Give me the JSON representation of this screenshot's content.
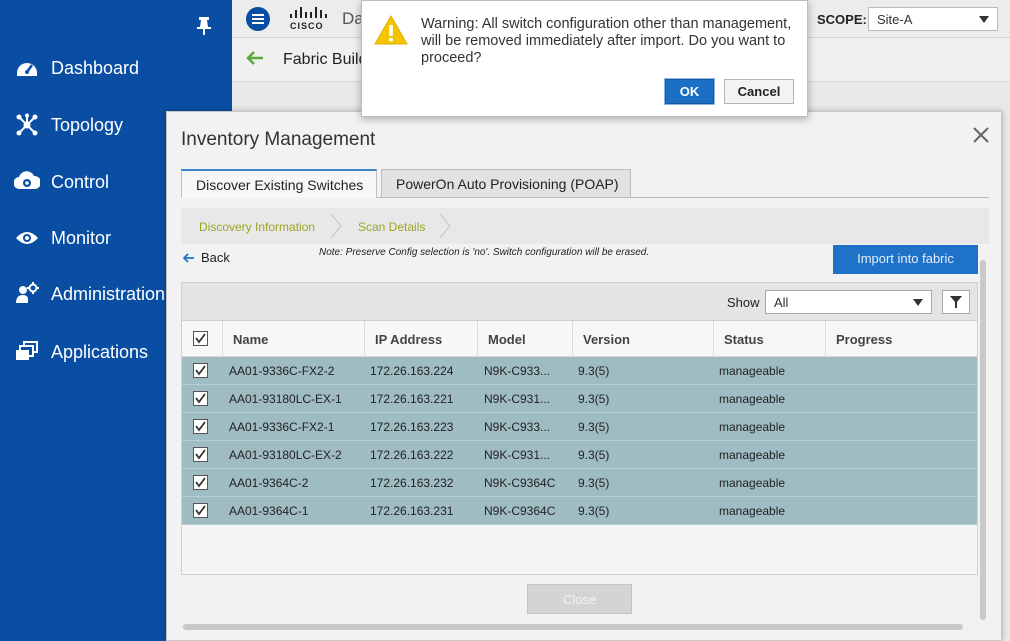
{
  "sidebar": {
    "items": [
      {
        "label": "Dashboard",
        "icon": "dashboard-icon"
      },
      {
        "label": "Topology",
        "icon": "topology-icon"
      },
      {
        "label": "Control",
        "icon": "control-icon"
      },
      {
        "label": "Monitor",
        "icon": "monitor-icon"
      },
      {
        "label": "Administration",
        "icon": "administration-icon"
      },
      {
        "label": "Applications",
        "icon": "applications-icon"
      }
    ]
  },
  "topbar": {
    "logo_text": "CISCO",
    "app_title": "Da",
    "scope_label": "SCOPE:",
    "scope_value": "Site-A"
  },
  "subheader": {
    "title": "Fabric Builder"
  },
  "dialog": {
    "message": "Warning: All switch configuration other than management, will be removed immediately after import. Do you want to proceed?",
    "ok_label": "OK",
    "cancel_label": "Cancel"
  },
  "modal": {
    "title": "Inventory Management",
    "tabs": [
      {
        "label": "Discover Existing Switches"
      },
      {
        "label": "PowerOn Auto Provisioning (POAP)"
      }
    ],
    "steps": [
      {
        "label": "Discovery Information"
      },
      {
        "label": "Scan Details"
      }
    ],
    "back_label": "Back",
    "note": "Note: Preserve Config selection is 'no'. Switch configuration will be erased.",
    "import_label": "Import into fabric",
    "show_label": "Show",
    "show_value": "All",
    "columns": {
      "name": "Name",
      "ip": "IP Address",
      "model": "Model",
      "version": "Version",
      "status": "Status",
      "progress": "Progress"
    },
    "rows": [
      {
        "name": "AA01-9336C-FX2-2",
        "ip": "172.26.163.224",
        "model": "N9K-C933...",
        "version": "9.3(5)",
        "status": "manageable",
        "progress": ""
      },
      {
        "name": "AA01-93180LC-EX-1",
        "ip": "172.26.163.221",
        "model": "N9K-C931...",
        "version": "9.3(5)",
        "status": "manageable",
        "progress": ""
      },
      {
        "name": "AA01-9336C-FX2-1",
        "ip": "172.26.163.223",
        "model": "N9K-C933...",
        "version": "9.3(5)",
        "status": "manageable",
        "progress": ""
      },
      {
        "name": "AA01-93180LC-EX-2",
        "ip": "172.26.163.222",
        "model": "N9K-C931...",
        "version": "9.3(5)",
        "status": "manageable",
        "progress": ""
      },
      {
        "name": "AA01-9364C-2",
        "ip": "172.26.163.232",
        "model": "N9K-C9364C",
        "version": "9.3(5)",
        "status": "manageable",
        "progress": ""
      },
      {
        "name": "AA01-9364C-1",
        "ip": "172.26.163.231",
        "model": "N9K-C9364C",
        "version": "9.3(5)",
        "status": "manageable",
        "progress": ""
      }
    ],
    "close_label": "Close"
  },
  "colors": {
    "sidebar_bg": "#0a4ea3",
    "row_selected": "#9fbcc3",
    "primary_button": "#1e73c8",
    "step_text": "#9aa527",
    "warning_yellow": "#f5c400"
  }
}
